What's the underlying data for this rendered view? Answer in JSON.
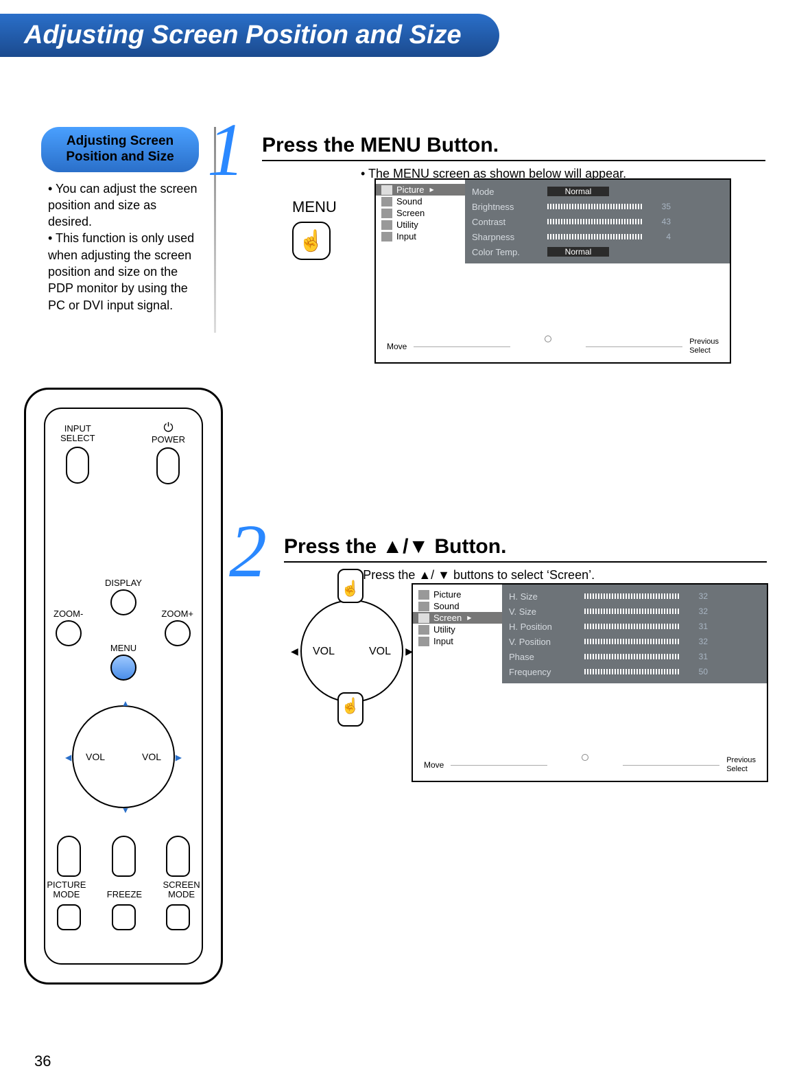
{
  "title": "Adjusting Screen Position and Size",
  "page_number": "36",
  "callout": {
    "heading": "Adjusting Screen Position and Size",
    "bullets": [
      "You can adjust the screen position and size as desired.",
      "This function is only used when adjusting the screen position and size on the PDP monitor by using the PC or DVI input signal."
    ]
  },
  "steps": {
    "one": {
      "num": "1",
      "head": "Press the MENU Button.",
      "sub": "• The MENU screen as shown below will appear.",
      "menu_label": "MENU"
    },
    "two": {
      "num": "2",
      "head": "Press the ▲/▼ Button.",
      "sub": "• Press the ▲/ ▼ buttons to select ‘Screen’.",
      "vol_left": "VOL",
      "vol_right": "VOL"
    }
  },
  "osd": {
    "nav": {
      "picture": "Picture",
      "sound": "Sound",
      "screen": "Screen",
      "utility": "Utility",
      "input": "Input"
    },
    "picture_vals": {
      "mode": {
        "label": "Mode",
        "value": "Normal"
      },
      "brightness": {
        "label": "Brightness",
        "value": "35"
      },
      "contrast": {
        "label": "Contrast",
        "value": "43"
      },
      "sharpness": {
        "label": "Sharpness",
        "value": "4"
      },
      "colortemp": {
        "label": "Color Temp.",
        "value": "Normal"
      }
    },
    "screen_vals": {
      "hsize": {
        "label": "H. Size",
        "value": "32"
      },
      "vsize": {
        "label": "V. Size",
        "value": "32"
      },
      "hpos": {
        "label": "H. Position",
        "value": "31"
      },
      "vpos": {
        "label": "V. Position",
        "value": "32"
      },
      "phase": {
        "label": "Phase",
        "value": "31"
      },
      "freq": {
        "label": "Frequency",
        "value": "50"
      }
    },
    "footer": {
      "move": "Move",
      "previous": "Previous",
      "select": "Select"
    }
  },
  "remote": {
    "input_select": "INPUT\nSELECT",
    "power": "POWER",
    "display": "DISPLAY",
    "zoom_minus": "ZOOM-",
    "zoom_plus": "ZOOM+",
    "menu": "MENU",
    "vol": "VOL",
    "picture_mode": "PICTURE\nMODE",
    "freeze": "FREEZE",
    "screen_mode": "SCREEN\nMODE"
  }
}
